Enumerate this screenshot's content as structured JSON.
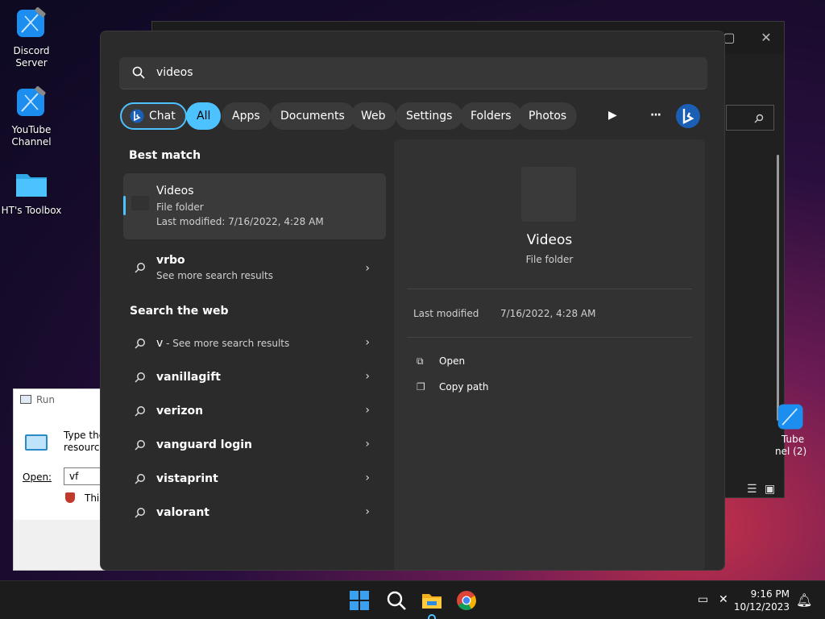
{
  "desktop": {
    "icons": [
      {
        "label_line1": "Discord",
        "label_line2": "Server",
        "icon": "xcode-hammer-icon"
      },
      {
        "label_line1": "YouTube",
        "label_line2": "Channel",
        "icon": "xcode-hammer-icon"
      },
      {
        "label_line1": "HT's Toolbox",
        "label_line2": "",
        "icon": "folder-icon"
      }
    ],
    "partial_icon": {
      "line1": "Tube",
      "line2": "nel (2)"
    }
  },
  "run_dialog": {
    "title": "Run",
    "desc_line1": "Type the",
    "desc_line2": "resource",
    "open_label": "Open:",
    "open_value": "vf",
    "shield_text": "This"
  },
  "search": {
    "value": "videos",
    "chips": [
      {
        "label": "Chat"
      },
      {
        "label": "All"
      },
      {
        "label": "Apps"
      },
      {
        "label": "Documents"
      },
      {
        "label": "Web"
      },
      {
        "label": "Settings"
      },
      {
        "label": "Folders"
      },
      {
        "label": "Photos"
      }
    ],
    "more_glyph": "···"
  },
  "results": {
    "best_match_heading": "Best match",
    "best_match": {
      "title": "Videos",
      "type": "File folder",
      "modified": "Last modified: 7/16/2022, 4:28 AM"
    },
    "vrbo": {
      "title": "vrbo",
      "sub": "See more search results"
    },
    "web_heading": "Search the web",
    "web_first": {
      "title": "v",
      "sub": " - See more search results"
    },
    "web_items": [
      "vanillagift",
      "verizon",
      "vanguard login",
      "vistaprint",
      "valorant"
    ]
  },
  "preview": {
    "title": "Videos",
    "type": "File folder",
    "modified_label": "Last modified",
    "modified_value": "7/16/2022, 4:28 AM",
    "actions": [
      {
        "label": "Open",
        "icon": "open-external-icon"
      },
      {
        "label": "Copy path",
        "icon": "copy-icon"
      }
    ]
  },
  "taskbar": {
    "time": "9:16 PM",
    "date": "10/12/2023"
  },
  "colors": {
    "accent": "#4cc2ff",
    "panel": "#2b2b2b",
    "taskbar": "#1c1c1c"
  }
}
